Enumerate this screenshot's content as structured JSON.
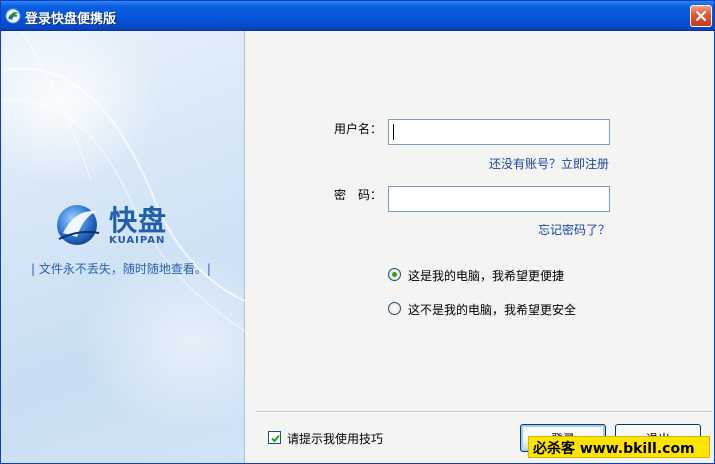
{
  "window": {
    "title": "登录快盘便携版",
    "icon": "kuaipan-app-icon",
    "close_icon": "close-icon"
  },
  "brand": {
    "name": "快盘",
    "name_latin": "KUAIPAN",
    "slogan": "| 文件永不丢失，随时随地查看。|",
    "accent_color": "#1f5fae"
  },
  "form": {
    "username_label": "用户名：",
    "username_value": "",
    "register_link": "还没有账号？立即注册",
    "password_label": "密　码：",
    "password_value": "",
    "forgot_link": "忘记密码了？"
  },
  "options": {
    "selected": "my_computer",
    "items": [
      {
        "id": "my_computer",
        "label": "这是我的电脑，我希望更便捷"
      },
      {
        "id": "not_my_computer",
        "label": "这不是我的电脑，我希望更安全"
      }
    ]
  },
  "tips": {
    "label": "请提示我使用技巧",
    "checked": true
  },
  "buttons": {
    "login": "登录",
    "exit": "退出"
  },
  "watermark": {
    "text": "必杀客 www.bkill.com"
  }
}
